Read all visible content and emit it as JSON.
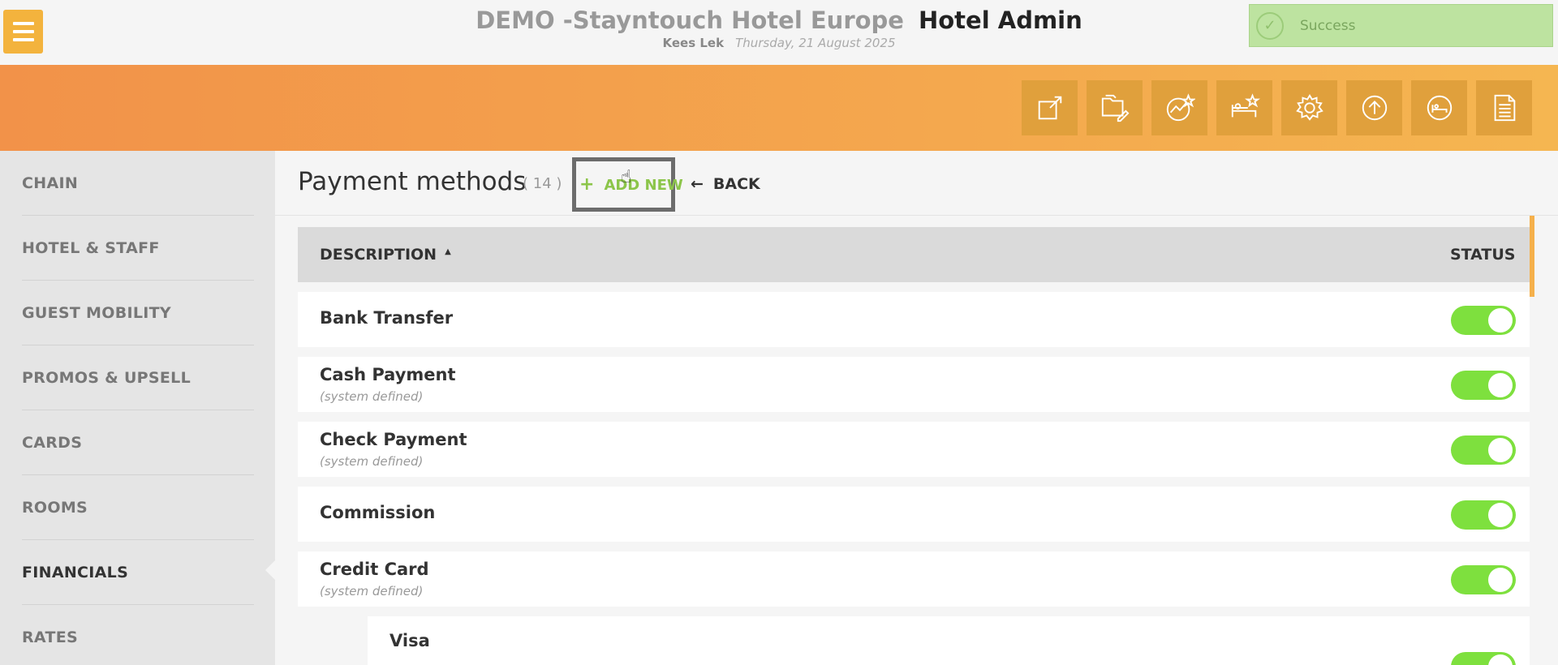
{
  "header": {
    "hotel_name": "DEMO -Stayntouch Hotel Europe",
    "app_name": "Hotel Admin",
    "user": "Kees Lek",
    "date": "Thursday, 21 August 2025"
  },
  "toast": {
    "message": "Success"
  },
  "toolbar": {
    "buttons": [
      "external-link-icon",
      "folder-edit-icon",
      "chart-star-icon",
      "bed-star-icon",
      "gear-icon",
      "upload-circle-icon",
      "room-circle-icon",
      "document-icon"
    ]
  },
  "sidebar": {
    "items": [
      {
        "label": "CHAIN"
      },
      {
        "label": "HOTEL & STAFF"
      },
      {
        "label": "GUEST MOBILITY"
      },
      {
        "label": "PROMOS & UPSELL"
      },
      {
        "label": "CARDS"
      },
      {
        "label": "ROOMS"
      },
      {
        "label": "FINANCIALS"
      },
      {
        "label": "RATES"
      }
    ],
    "active": "FINANCIALS"
  },
  "main": {
    "title": "Payment methods",
    "count": "( 14 )",
    "add_new_label": "ADD NEW",
    "back_label": "BACK",
    "columns": {
      "description": "DESCRIPTION",
      "status": "STATUS"
    },
    "rows": [
      {
        "name": "Bank Transfer",
        "sub": "",
        "status": "on"
      },
      {
        "name": "Cash Payment",
        "sub": "(system defined)",
        "status": "on"
      },
      {
        "name": "Check Payment",
        "sub": "(system defined)",
        "status": "on"
      },
      {
        "name": "Commission",
        "sub": "",
        "status": "on"
      },
      {
        "name": "Credit Card",
        "sub": "(system defined)",
        "status": "on"
      },
      {
        "name": "Visa",
        "sub": "",
        "status": "on"
      }
    ]
  },
  "colors": {
    "accent_orange": "#f29249",
    "toggle_on": "#7ee03e",
    "add_new_green": "#8cc54a",
    "menu_yellow": "#f3b33d"
  }
}
